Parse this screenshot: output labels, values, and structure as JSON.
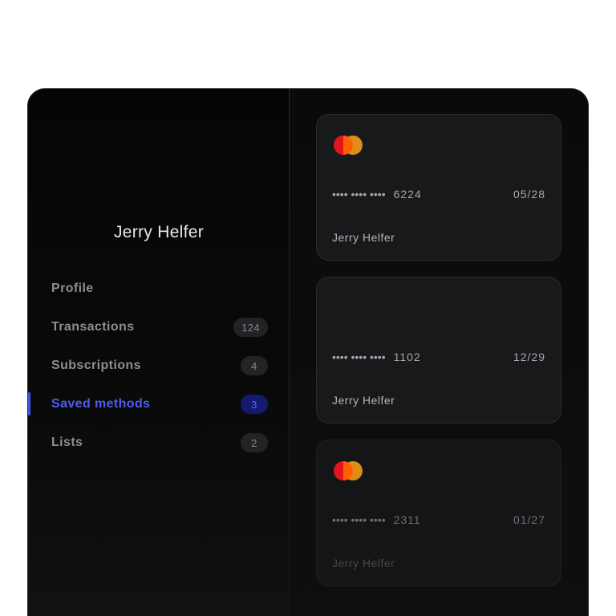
{
  "user": {
    "name": "Jerry Helfer"
  },
  "nav": {
    "items": [
      {
        "label": "Profile",
        "count": null
      },
      {
        "label": "Transactions",
        "count": "124"
      },
      {
        "label": "Subscriptions",
        "count": "4"
      },
      {
        "label": "Saved methods",
        "count": "3",
        "active": true
      },
      {
        "label": "Lists",
        "count": "2"
      }
    ]
  },
  "cards": [
    {
      "brand_icon": "mastercard-icon",
      "masked": "••••  ••••  ••••",
      "last4": "6224",
      "expiry": "05/28",
      "holder": "Jerry Helfer"
    },
    {
      "brand_icon": null,
      "masked": "••••  ••••  ••••",
      "last4": "1102",
      "expiry": "12/29",
      "holder": "Jerry Helfer"
    },
    {
      "brand_icon": "mastercard-icon",
      "masked": "••••  ••••  ••••",
      "last4": "2311",
      "expiry": "01/27",
      "holder": "Jerry Helfer"
    }
  ],
  "colors": {
    "accent": "#4c5cf5",
    "background": "#0d0e0f",
    "card": "#18191a",
    "mastercard_red": "#e3141c",
    "mastercard_orange": "#f59a1b"
  }
}
